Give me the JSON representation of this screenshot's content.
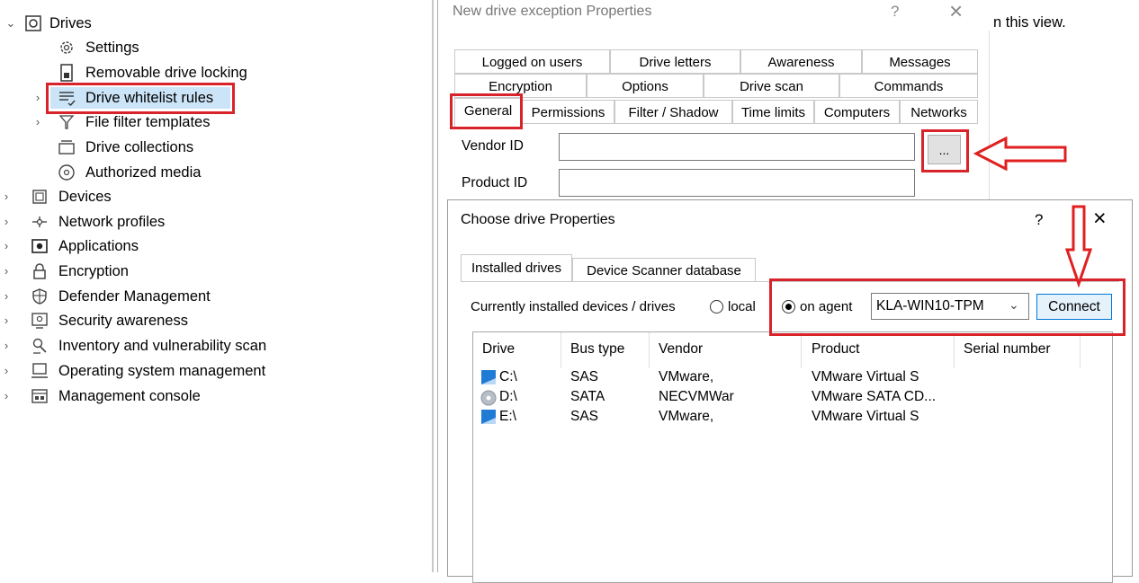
{
  "tree": {
    "items": [
      {
        "label": "Drives",
        "icon": "drive-icon",
        "expander": "expanded"
      },
      {
        "label": "Settings",
        "icon": "gear-icon",
        "expander": ""
      },
      {
        "label": "Removable drive locking",
        "icon": "lock-drive-icon",
        "expander": ""
      },
      {
        "label": "Drive whitelist rules",
        "icon": "list-check-icon",
        "expander": "collapsed",
        "selected": true
      },
      {
        "label": "File filter templates",
        "icon": "filter-icon",
        "expander": "collapsed"
      },
      {
        "label": "Drive collections",
        "icon": "collection-icon",
        "expander": ""
      },
      {
        "label": "Authorized media",
        "icon": "authorized-media-icon",
        "expander": ""
      },
      {
        "label": "Devices",
        "icon": "devices-icon",
        "expander": "collapsed"
      },
      {
        "label": "Network profiles",
        "icon": "network-icon",
        "expander": "collapsed"
      },
      {
        "label": "Applications",
        "icon": "applications-icon",
        "expander": "collapsed"
      },
      {
        "label": "Encryption",
        "icon": "padlock-icon",
        "expander": "collapsed"
      },
      {
        "label": "Defender Management",
        "icon": "shield-icon",
        "expander": "collapsed"
      },
      {
        "label": "Security awareness",
        "icon": "awareness-icon",
        "expander": "collapsed"
      },
      {
        "label": "Inventory and vulnerability scan",
        "icon": "inventory-icon",
        "expander": "collapsed"
      },
      {
        "label": "Operating system management",
        "icon": "computer-icon",
        "expander": "collapsed"
      },
      {
        "label": "Management console",
        "icon": "console-icon",
        "expander": "collapsed"
      }
    ]
  },
  "background_text": "n this view.",
  "exception_dialog": {
    "title": "New drive exception Properties",
    "help": "?",
    "close": "×",
    "tabs_row1": [
      "Logged on users",
      "Drive letters",
      "Awareness",
      "Messages"
    ],
    "tabs_row2": [
      "Encryption",
      "Options",
      "Drive scan",
      "Commands"
    ],
    "tabs_row3": [
      "General",
      "Permissions",
      "Filter / Shadow",
      "Time limits",
      "Computers",
      "Networks"
    ],
    "vendor_label": "Vendor ID",
    "product_label": "Product ID",
    "vendor_value": "",
    "product_value": "",
    "browse_label": "..."
  },
  "choose_dialog": {
    "title": "Choose drive Properties",
    "help": "?",
    "close": "×",
    "tabs": [
      "Installed drives",
      "Device Scanner database"
    ],
    "installed_label": "Currently installed devices / drives",
    "radio_local": "local",
    "radio_agent": "on agent",
    "agent_value": "KLA-WIN10-TPM",
    "connect_label": "Connect",
    "columns": [
      "Drive",
      "Bus type",
      "Vendor",
      "Product",
      "Serial number"
    ],
    "rows": [
      {
        "drive": "C:\\",
        "bus": "SAS",
        "vendor": "VMware,",
        "product": "VMware Virtual S",
        "serial": "",
        "icon": "hard-drive-icon"
      },
      {
        "drive": "D:\\",
        "bus": "SATA",
        "vendor": "NECVMWar",
        "product": "VMware SATA CD...",
        "serial": "",
        "icon": "cd-drive-icon"
      },
      {
        "drive": "E:\\",
        "bus": "SAS",
        "vendor": "VMware,",
        "product": "VMware Virtual S",
        "serial": "",
        "icon": "hard-drive-icon"
      }
    ]
  },
  "colors": {
    "highlight": "#d9232a",
    "accent": "#0078d7"
  }
}
